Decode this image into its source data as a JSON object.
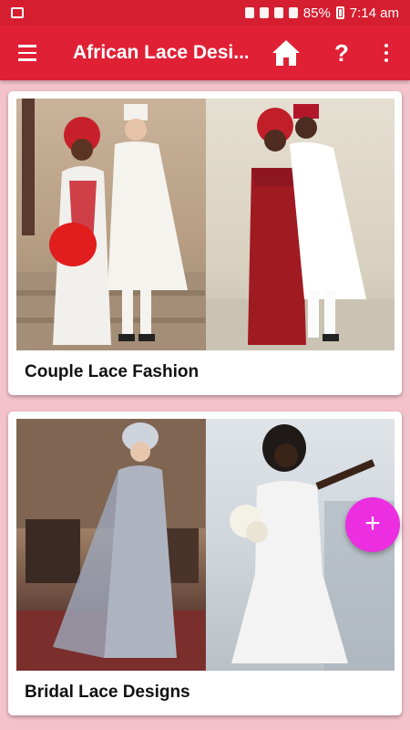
{
  "status_bar": {
    "battery": "85%",
    "time": "7:14 am"
  },
  "app_bar": {
    "title": "African Lace Desi...",
    "help_symbol": "?"
  },
  "cards": [
    {
      "label": "Couple Lace Fashion"
    },
    {
      "label": "Bridal Lace Designs"
    }
  ],
  "fab": {
    "symbol": "+"
  },
  "colors": {
    "primary": "#e02035",
    "status_bar": "#d51e30",
    "background": "#f4c2cc",
    "accent": "#ea2ee0"
  }
}
